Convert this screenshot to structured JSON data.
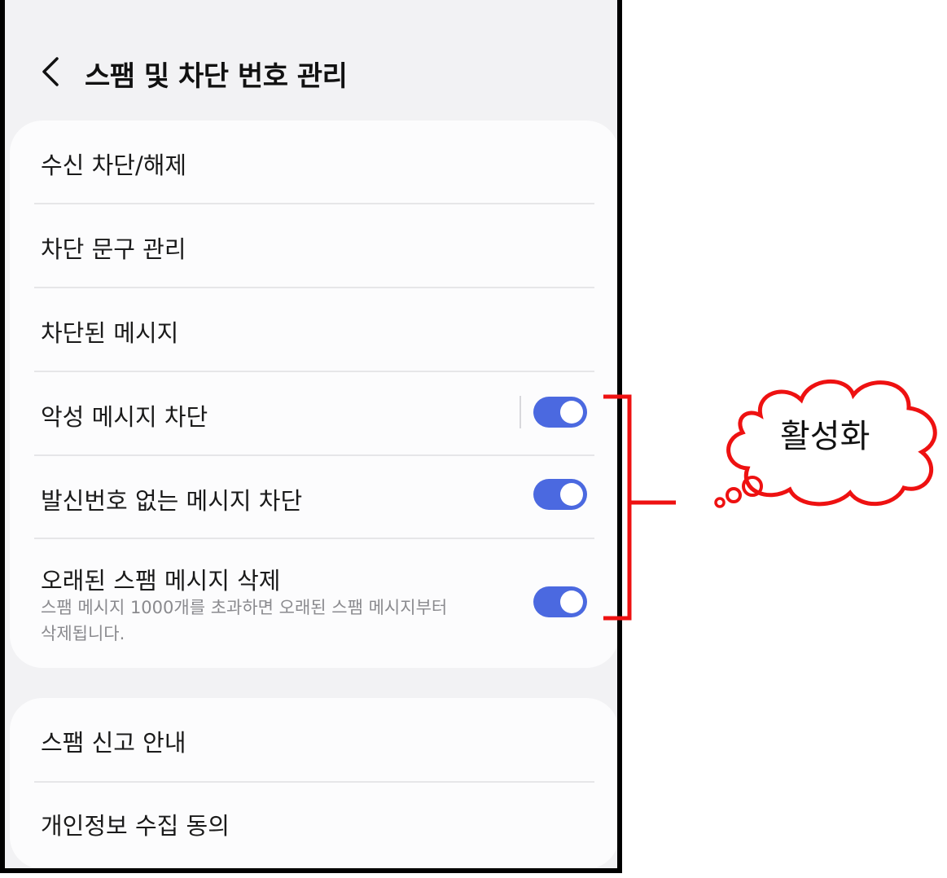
{
  "header": {
    "title": "스팸 및 차단 번호 관리",
    "back_icon": "chevron-left-icon"
  },
  "sections": [
    {
      "items": [
        {
          "label": "수신 차단/해제"
        },
        {
          "label": "차단 문구 관리"
        },
        {
          "label": "차단된 메시지"
        },
        {
          "label": "악성 메시지 차단",
          "toggle": true
        },
        {
          "label": "발신번호 없는 메시지 차단",
          "toggle": true
        },
        {
          "label": "오래된 스팸 메시지 삭제",
          "toggle": true,
          "description_line1": "스팸 메시지 1000개를 초과하면 오래된 스팸 메시지부터",
          "description_line2": "삭제됩니다."
        }
      ]
    },
    {
      "items": [
        {
          "label": "스팸 신고 안내"
        },
        {
          "label": "개인정보 수집 동의"
        }
      ]
    }
  ],
  "annotation": {
    "text": "활성화",
    "color": "#ee1111"
  },
  "colors": {
    "toggle_on": "#4b69e0",
    "background": "#f2f2f4",
    "card": "#fcfcfd"
  }
}
